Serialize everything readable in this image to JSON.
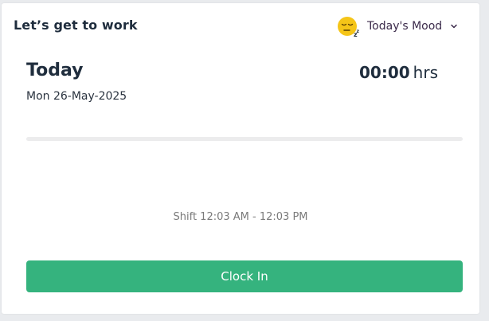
{
  "header": {
    "title": "Let’s get to work",
    "mood_label": "Today's Mood",
    "mood_icon": "sleepy-face-icon"
  },
  "today": {
    "heading": "Today",
    "date": "Mon 26-May-2025",
    "hours_value": "00:00",
    "hours_unit": "hrs",
    "progress_fraction": 0
  },
  "shift": {
    "text": "Shift 12:03 AM - 12:03 PM"
  },
  "actions": {
    "clock_in_label": "Clock In"
  },
  "colors": {
    "accent": "#35b37e",
    "mood_icon": "#f5c518",
    "title": "#1f2d3d"
  }
}
